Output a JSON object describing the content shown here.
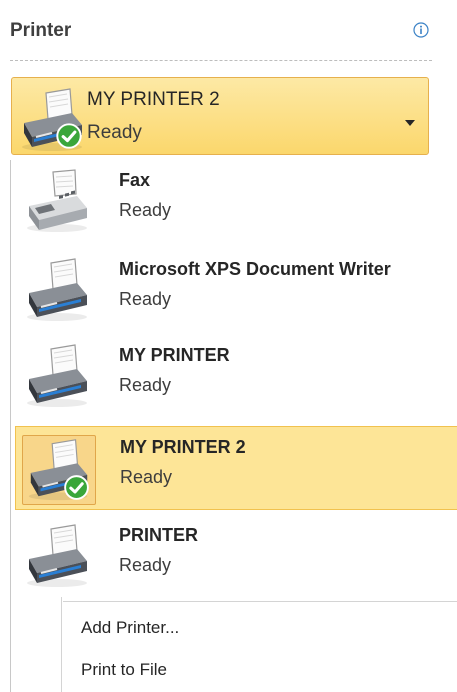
{
  "header": {
    "title": "Printer",
    "info_icon": "info-circle-icon"
  },
  "selected_printer": {
    "name": "MY PRINTER 2",
    "status": "Ready",
    "icon": "printer-default-icon",
    "dropdown_icon": "chevron-down-icon"
  },
  "printers": [
    {
      "name": "Fax",
      "status": "Ready",
      "icon": "fax-icon"
    },
    {
      "name": "Microsoft XPS Document Writer",
      "status": "Ready",
      "icon": "printer-icon"
    },
    {
      "name": "MY PRINTER",
      "status": "Ready",
      "icon": "printer-icon"
    },
    {
      "name": "MY PRINTER 2",
      "status": "Ready",
      "icon": "printer-default-icon",
      "selected": true
    },
    {
      "name": "PRINTER",
      "status": "Ready",
      "icon": "printer-icon"
    }
  ],
  "commands": {
    "add_printer": "Add Printer...",
    "print_to_file": "Print to File"
  },
  "colors": {
    "highlight": "#fde597",
    "highlight_border": "#f1c24f",
    "check_badge": "#3aa63a"
  }
}
